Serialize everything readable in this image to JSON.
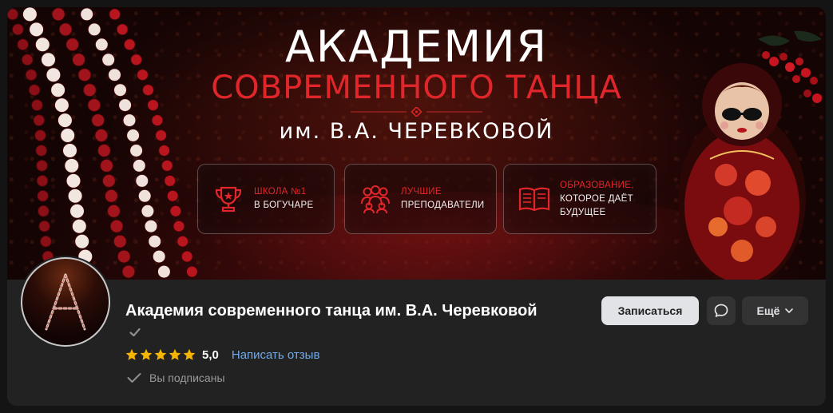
{
  "cover": {
    "title_line1": "АКАДЕМИЯ",
    "title_line2": "СОВРЕМЕННОГО ТАНЦА",
    "title_line3": "им. В.А. ЧЕРЕВКОВОЙ",
    "features": [
      {
        "icon": "trophy-icon",
        "red": "ШКОЛА №1",
        "white": "В БОГУЧАРЕ"
      },
      {
        "icon": "people-icon",
        "red": "ЛУЧШИЕ",
        "white": "ПРЕПОДАВАТЕЛИ"
      },
      {
        "icon": "book-icon",
        "red": "ОБРАЗОВАНИЕ,",
        "white": "КОТОРОЕ ДАЁТ",
        "white2": "БУДУЩЕЕ"
      }
    ]
  },
  "group": {
    "name": "Академия современного танца им. В.А. Черевковой",
    "verified": true,
    "rating": "5,0",
    "stars": 5,
    "review_link": "Написать отзыв",
    "subscribed": "Вы подписаны",
    "avatar_letter": "A"
  },
  "actions": {
    "join": "Записаться",
    "message_icon": "message-icon",
    "more": "Ещё"
  },
  "colors": {
    "accent_red": "#e0262a",
    "link_blue": "#71aaeb",
    "panel_bg": "#222222",
    "star": "#f5b400"
  }
}
